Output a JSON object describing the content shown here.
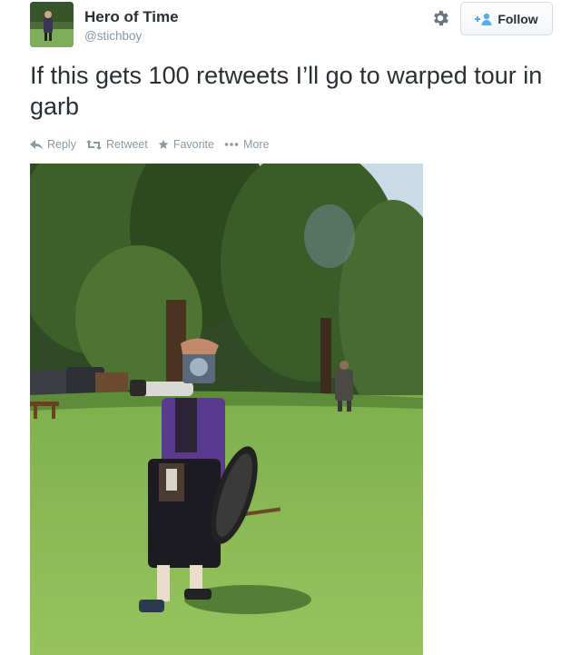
{
  "user": {
    "name": "Hero of Time",
    "handle": "@stichboy"
  },
  "follow_button": {
    "label": "Follow"
  },
  "tweet": {
    "text": "If this gets 100 retweets I’ll go to warped tour in garb"
  },
  "actions": [
    {
      "icon": "reply-icon",
      "label": "Reply"
    },
    {
      "icon": "retweet-icon",
      "label": "Retweet"
    },
    {
      "icon": "star-icon",
      "label": "Favorite"
    },
    {
      "icon": "more-dots-icon",
      "label": "More"
    }
  ],
  "colors": {
    "text": "#292f33",
    "secondary": "#8899a6",
    "follow_icon": "#55acee"
  }
}
